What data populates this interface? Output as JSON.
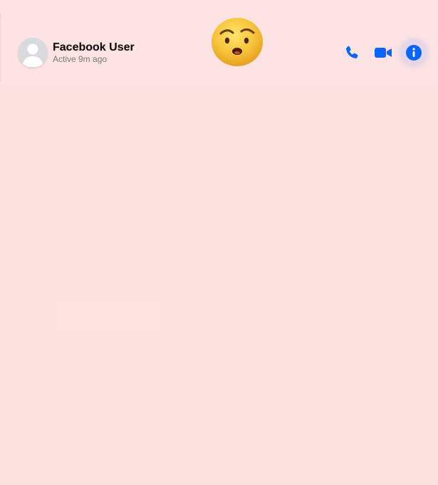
{
  "header": {
    "contact_name": "Facebook User",
    "status": "Active 9m ago",
    "avatar_icon": "default-user-avatar",
    "emoji_icon": "suspicious-face-emoji",
    "actions": {
      "call_icon": "phone-icon",
      "video_icon": "video-camera-icon",
      "info_icon": "info-icon"
    }
  },
  "colors": {
    "background": "#fde1e1",
    "accent": "#0866ff",
    "name_text": "#0b0b0b",
    "status_text": "#7a7a7a"
  }
}
